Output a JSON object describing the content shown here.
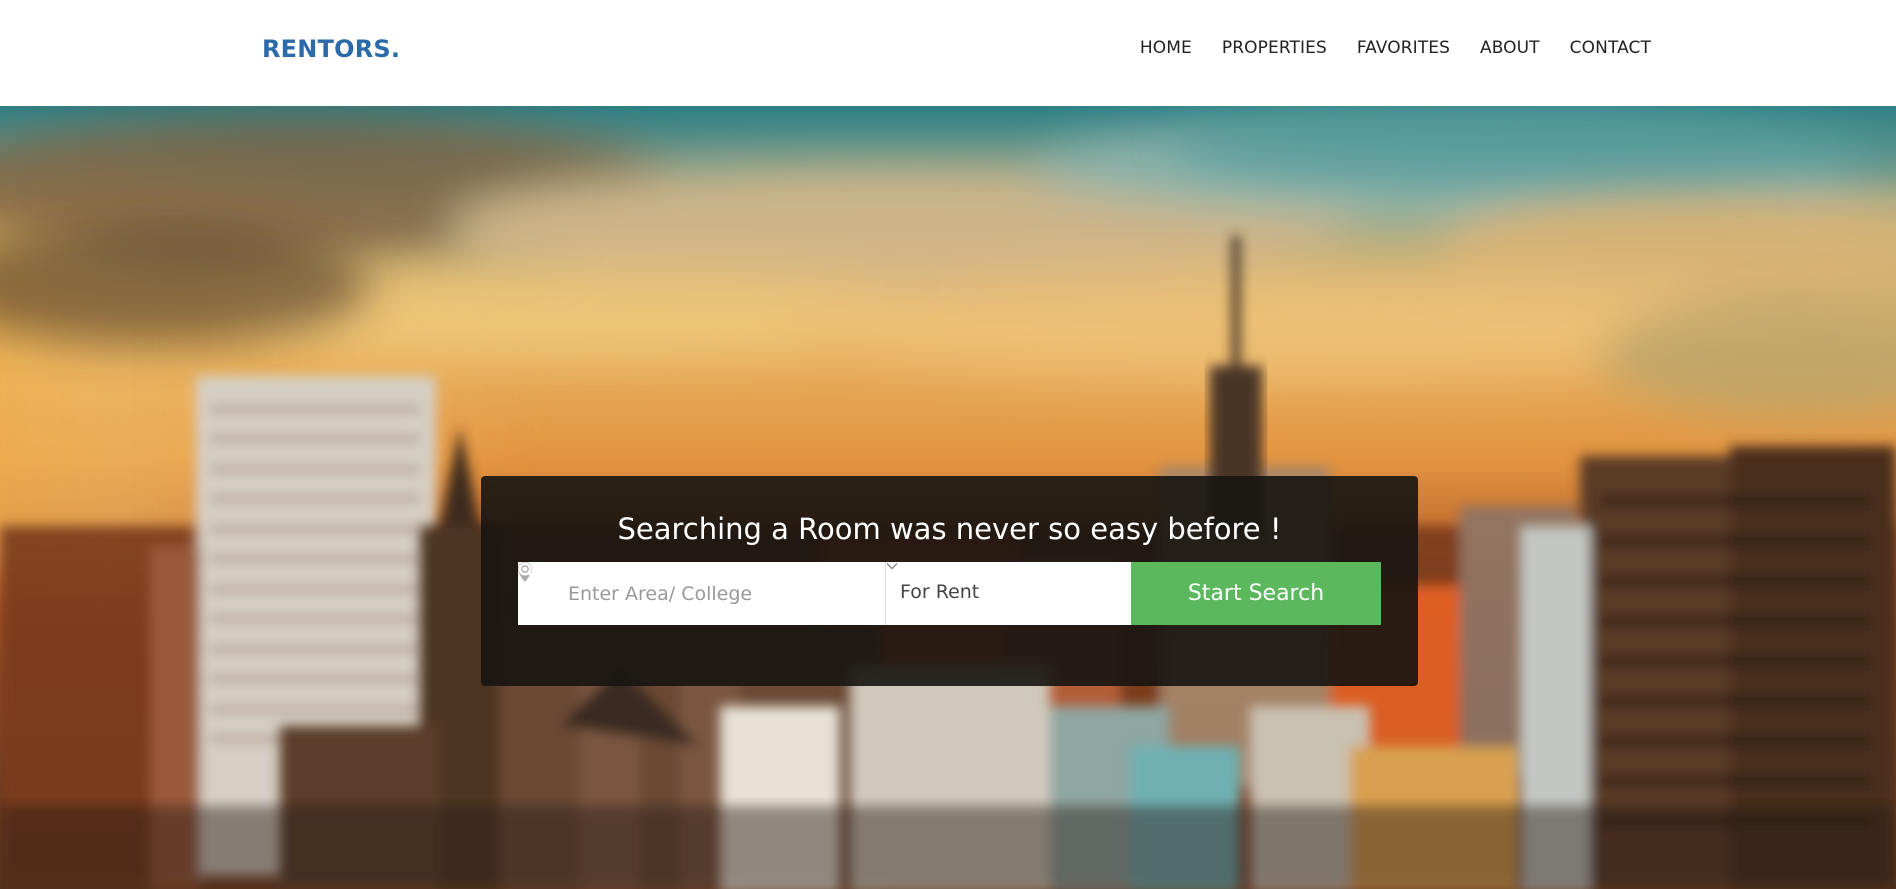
{
  "header": {
    "brand": "RENTORS.",
    "nav": [
      {
        "label": "HOME"
      },
      {
        "label": "PROPERTIES"
      },
      {
        "label": "FAVORITES"
      },
      {
        "label": "ABOUT"
      },
      {
        "label": "CONTACT"
      }
    ]
  },
  "hero": {
    "background_icon": "city-skyline-image",
    "search": {
      "title": "Searching a Room was never so easy before !",
      "area_placeholder": "Enter Area/ College",
      "area_icon": "map-pin-icon",
      "type_selected": "For Rent",
      "type_icon": "chevron-down-icon",
      "button_label": "Start Search",
      "button_icon": "search-icon"
    }
  },
  "colors": {
    "brand": "#2c6aa8",
    "search_button": "#5cb85c",
    "panel": "#16140f",
    "nav_text": "#222222"
  }
}
